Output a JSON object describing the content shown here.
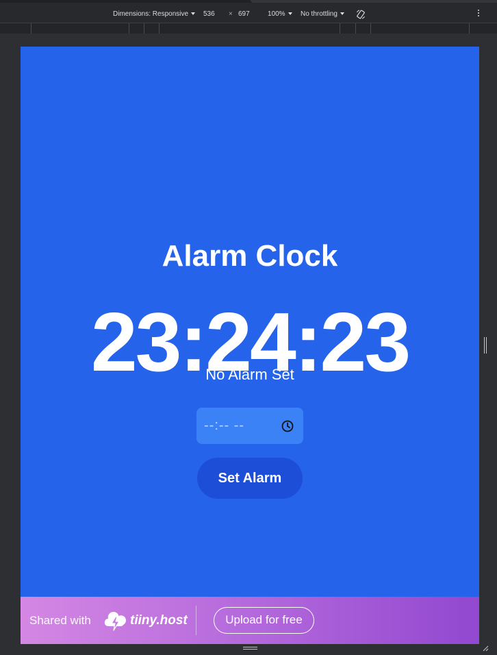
{
  "devtools": {
    "dimensions_label": "Dimensions: Responsive",
    "width_value": "536",
    "times_sign": "×",
    "height_value": "697",
    "zoom_label": "100%",
    "throttling_label": "No throttling",
    "icons": [
      "rotate-icon",
      "kebab-menu-icon",
      "resize-handle-icon",
      "corner-resize-icon"
    ]
  },
  "app": {
    "title": "Alarm Clock",
    "current_time": "23:24:23",
    "status": "No Alarm Set",
    "time_input": {
      "placeholder": "--:-- --",
      "icon": "clock-icon"
    },
    "set_button_label": "Set Alarm",
    "colors": {
      "background": "#2563eb",
      "input_bg": "#3b82f6",
      "button_bg": "#1d4ed8",
      "text": "#ffffff"
    }
  },
  "footer": {
    "shared_with": "Shared with",
    "brand_name": "tiiny.host",
    "upload_label": "Upload for free",
    "gradient": [
      "#d487e3",
      "#9248cf"
    ]
  }
}
